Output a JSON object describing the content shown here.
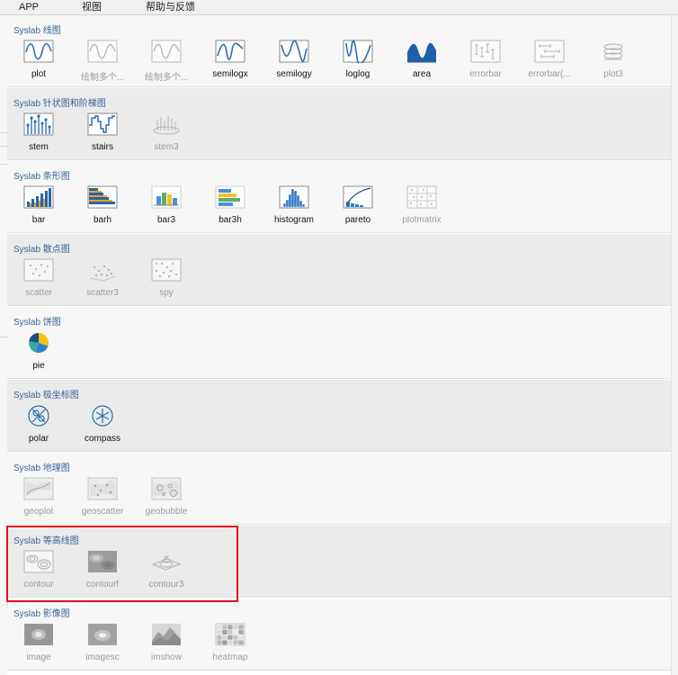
{
  "menu": {
    "app": "APP",
    "view": "视图",
    "help": "帮助与反馈"
  },
  "sections": [
    {
      "title": "Syslab 线图",
      "items": [
        {
          "label": "plot",
          "icon": "plot-line-icon",
          "enabled": true
        },
        {
          "label": "绘制多个...",
          "icon": "plot-multi-icon",
          "enabled": false
        },
        {
          "label": "绘制多个...",
          "icon": "plot-multi-icon",
          "enabled": false
        },
        {
          "label": "semilogx",
          "icon": "semilogx-icon",
          "enabled": true
        },
        {
          "label": "semilogy",
          "icon": "semilogy-icon",
          "enabled": true
        },
        {
          "label": "loglog",
          "icon": "loglog-icon",
          "enabled": true
        },
        {
          "label": "area",
          "icon": "area-icon",
          "enabled": true
        },
        {
          "label": "errorbar",
          "icon": "errorbar-icon",
          "enabled": false
        },
        {
          "label": "errorbar(...",
          "icon": "errorbar-horizontal-icon",
          "enabled": false
        },
        {
          "label": "plot3",
          "icon": "plot3-icon",
          "enabled": false
        }
      ]
    },
    {
      "title": "Syslab 针状图和阶梯图",
      "items": [
        {
          "label": "stem",
          "icon": "stem-icon",
          "enabled": true
        },
        {
          "label": "stairs",
          "icon": "stairs-icon",
          "enabled": true
        },
        {
          "label": "stem3",
          "icon": "stem3-icon",
          "enabled": false
        }
      ]
    },
    {
      "title": "Syslab 条形图",
      "items": [
        {
          "label": "bar",
          "icon": "bar-icon",
          "enabled": true
        },
        {
          "label": "barh",
          "icon": "barh-icon",
          "enabled": true
        },
        {
          "label": "bar3",
          "icon": "bar3-icon",
          "enabled": true
        },
        {
          "label": "bar3h",
          "icon": "bar3h-icon",
          "enabled": true
        },
        {
          "label": "histogram",
          "icon": "histogram-icon",
          "enabled": true
        },
        {
          "label": "pareto",
          "icon": "pareto-icon",
          "enabled": true
        },
        {
          "label": "plotmatrix",
          "icon": "plotmatrix-icon",
          "enabled": false
        }
      ]
    },
    {
      "title": "Syslab 散点图",
      "items": [
        {
          "label": "scatter",
          "icon": "scatter-icon",
          "enabled": false
        },
        {
          "label": "scatter3",
          "icon": "scatter3-icon",
          "enabled": false
        },
        {
          "label": "spy",
          "icon": "spy-icon",
          "enabled": false
        }
      ]
    },
    {
      "title": "Syslab 饼图",
      "items": [
        {
          "label": "pie",
          "icon": "pie-icon",
          "enabled": true
        }
      ]
    },
    {
      "title": "Syslab 极坐标图",
      "items": [
        {
          "label": "polar",
          "icon": "polar-icon",
          "enabled": true
        },
        {
          "label": "compass",
          "icon": "compass-icon",
          "enabled": true
        }
      ]
    },
    {
      "title": "Syslab 地理图",
      "items": [
        {
          "label": "geoplot",
          "icon": "geoplot-icon",
          "enabled": false
        },
        {
          "label": "geoscatter",
          "icon": "geoscatter-icon",
          "enabled": false
        },
        {
          "label": "geobubble",
          "icon": "geobubble-icon",
          "enabled": false
        }
      ]
    },
    {
      "title": "Syslab 等高线图",
      "items": [
        {
          "label": "contour",
          "icon": "contour-icon",
          "enabled": false
        },
        {
          "label": "contourf",
          "icon": "contourf-icon",
          "enabled": false
        },
        {
          "label": "contour3",
          "icon": "contour3-icon",
          "enabled": false
        }
      ]
    },
    {
      "title": "Syslab 影像图",
      "items": [
        {
          "label": "image",
          "icon": "image-icon",
          "enabled": false
        },
        {
          "label": "imagesc",
          "icon": "imagesc-icon",
          "enabled": false
        },
        {
          "label": "imshow",
          "icon": "imshow-icon",
          "enabled": false
        },
        {
          "label": "heatmap",
          "icon": "heatmap-icon",
          "enabled": false
        }
      ]
    }
  ],
  "colors": {
    "accent": "#34639a",
    "highlight": "#e0141b",
    "icon_blue": "#2b6cb0"
  }
}
